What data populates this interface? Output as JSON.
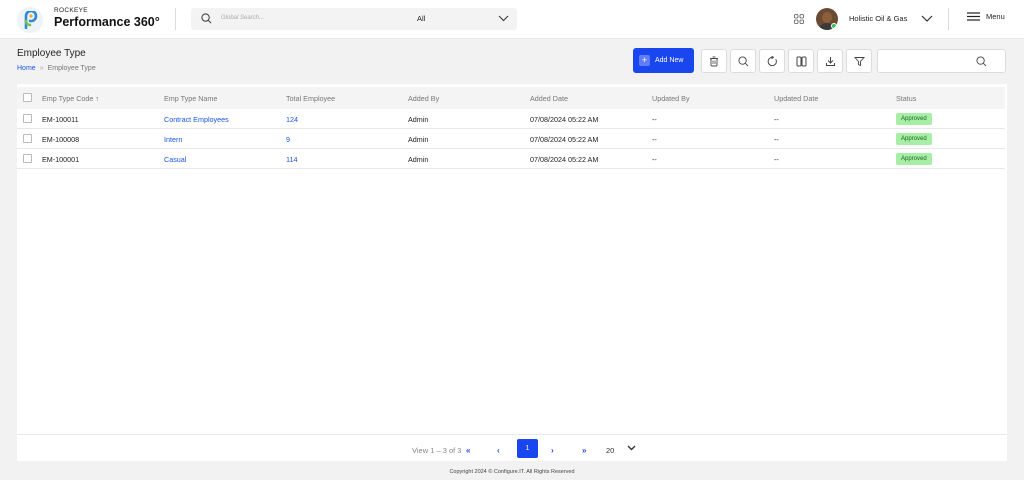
{
  "header": {
    "brand_small": "ROCKEYE",
    "brand_big": "Performance 360°",
    "search_placeholder": "Global Search...",
    "search_scope": "All",
    "company": "Holistic Oil & Gas",
    "menu_label": "Menu"
  },
  "page": {
    "title": "Employee Type",
    "breadcrumb": [
      "Home",
      "»",
      "Employee Type"
    ],
    "add_new_label": "Add New"
  },
  "table": {
    "columns": [
      "Emp Type Code",
      "Emp Type Name",
      "Total Employee",
      "Added By",
      "Added Date",
      "Updated By",
      "Updated Date",
      "Status"
    ],
    "rows": [
      {
        "code": "EM-100011",
        "name": "Contract Employees",
        "total": "124",
        "added_by": "Admin",
        "added_date": "07/08/2024 05:22 AM",
        "updated_by": "--",
        "updated_date": "--",
        "status": "Approved"
      },
      {
        "code": "EM-100008",
        "name": "Intern",
        "total": "9",
        "added_by": "Admin",
        "added_date": "07/08/2024 05:22 AM",
        "updated_by": "--",
        "updated_date": "--",
        "status": "Approved"
      },
      {
        "code": "EM-100001",
        "name": "Casual",
        "total": "114",
        "added_by": "Admin",
        "added_date": "07/08/2024 05:22 AM",
        "updated_by": "--",
        "updated_date": "--",
        "status": "Approved"
      }
    ]
  },
  "pagination": {
    "view_text": "View 1 – 3 of 3",
    "first": "«",
    "prev": "‹",
    "current_page": "1",
    "next": "›",
    "last": "»",
    "page_size": "20"
  },
  "footer": {
    "copyright": "Copyright 2024 © Configure.IT. All Rights Reserved"
  },
  "colors": {
    "accent": "#1a46f0",
    "link": "#1a56e8",
    "approved_bg": "#a8eea6"
  },
  "icons": [
    "search-icon",
    "chevron-down-icon",
    "apps-grid-icon",
    "menu-icon",
    "trash-icon",
    "refresh-icon",
    "columns-icon",
    "export-icon",
    "filter-icon",
    "sort-arrow-icon"
  ]
}
